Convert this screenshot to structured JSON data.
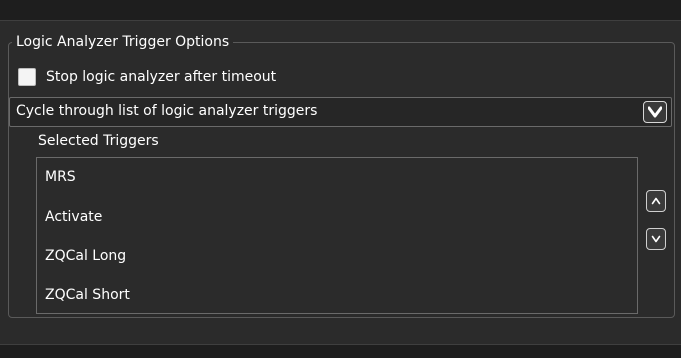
{
  "group": {
    "title": "Logic Analyzer Trigger Options"
  },
  "timeout_checkbox": {
    "label": "Stop logic analyzer after timeout",
    "checked": false
  },
  "trigger_mode_dropdown": {
    "selected": "Cycle through list of logic analyzer triggers",
    "icon": "chevron-down-icon"
  },
  "selected_triggers": {
    "label": "Selected Triggers",
    "items": [
      "MRS",
      "Activate",
      "ZQCal Long",
      "ZQCal Short"
    ]
  },
  "reorder_buttons": {
    "up_icon": "chevron-up-icon",
    "down_icon": "chevron-down-icon"
  },
  "colors": {
    "background": "#2b2b2b",
    "text": "#ffffff",
    "border": "#6a6a6a"
  }
}
